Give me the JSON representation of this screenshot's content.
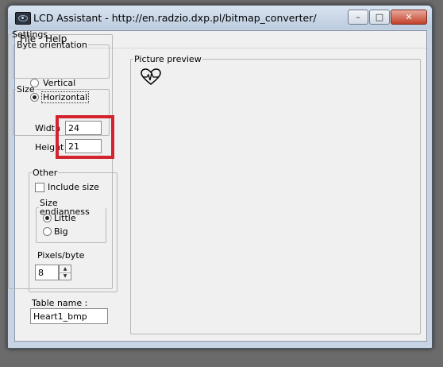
{
  "window": {
    "title": "LCD Assistant -  http://en.radzio.dxp.pl/bitmap_converter/",
    "controls": {
      "minimize": "–",
      "maximize": "□",
      "close": "✕"
    }
  },
  "menu": {
    "file": "File",
    "help": "Help"
  },
  "settings": {
    "legend": "Settings",
    "byte_orientation": {
      "legend": "Byte orientation",
      "options": [
        "Vertical",
        "Horizontal"
      ],
      "selected": "Horizontal"
    },
    "size": {
      "legend": "Size",
      "width_label": "Width",
      "width_value": "24",
      "height_label": "Height",
      "height_value": "21"
    },
    "other": {
      "legend": "Other",
      "include_size_label": "Include size",
      "include_size_checked": false,
      "size_endianness": {
        "legend": "Size endianness",
        "options": [
          "Little",
          "Big"
        ],
        "selected": "Little"
      },
      "pixels_per_byte_label": "Pixels/byte",
      "pixels_per_byte_value": "8"
    },
    "table_name_label": "Table name :",
    "table_name_value": "Heart1_bmp"
  },
  "preview": {
    "legend": "Picture preview",
    "image_icon": "heart-ecg-icon"
  },
  "colors": {
    "highlight": "#d2232f",
    "close_button": "#c2412b"
  }
}
